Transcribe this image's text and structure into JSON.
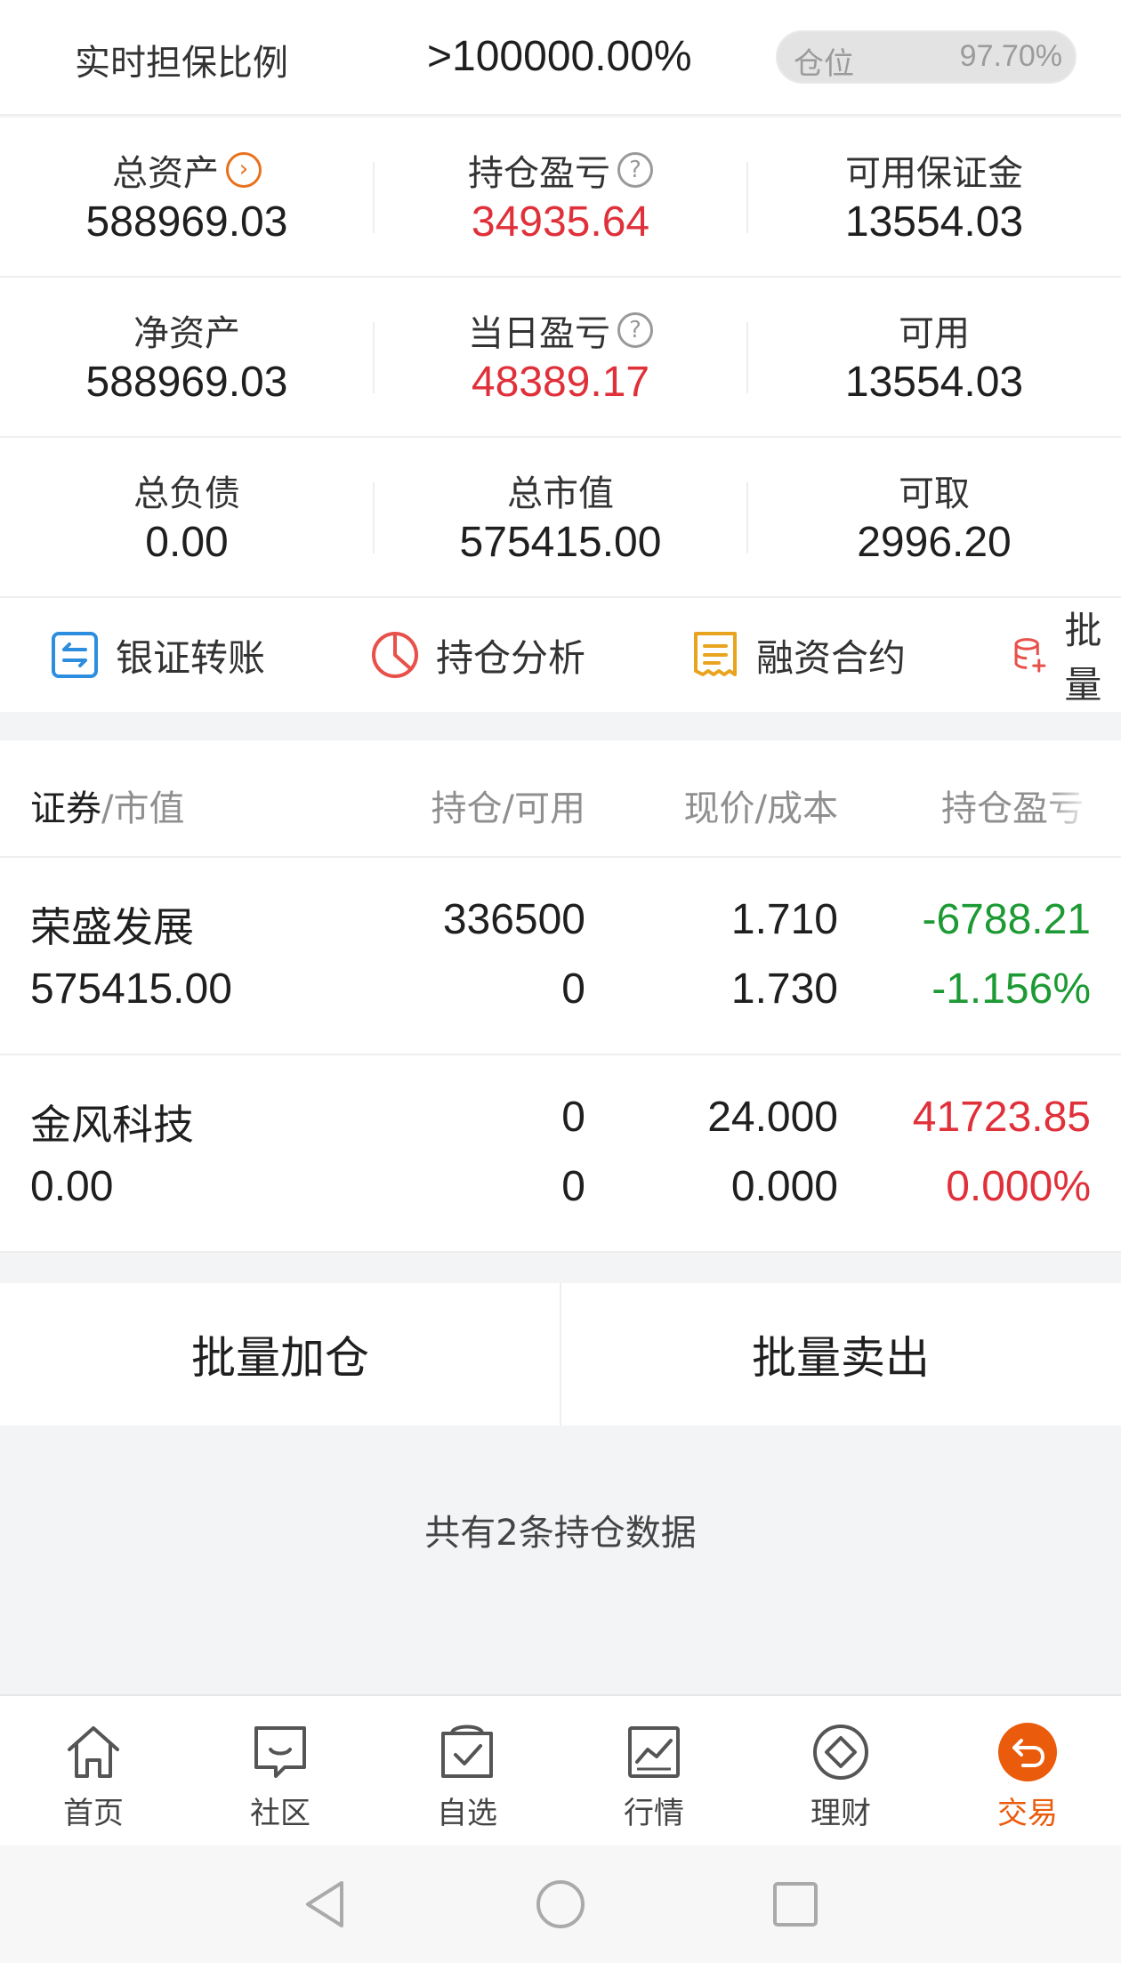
{
  "header": {
    "label": "实时担保比例",
    "ratio": ">100000.00%",
    "position_label": "仓位",
    "position_value": "97.70%"
  },
  "assets": {
    "row1": [
      {
        "label": "总资产",
        "value": "588969.03",
        "icon": "chevron-right-circle-icon",
        "color": "#1f1f1f"
      },
      {
        "label": "持仓盈亏",
        "value": "34935.64",
        "icon": "question-circle-icon",
        "color": "#e0303a"
      },
      {
        "label": "可用保证金",
        "value": "13554.03",
        "color": "#1f1f1f"
      }
    ],
    "row2": [
      {
        "label": "净资产",
        "value": "588969.03",
        "color": "#1f1f1f"
      },
      {
        "label": "当日盈亏",
        "value": "48389.17",
        "icon": "question-circle-icon",
        "color": "#e0303a"
      },
      {
        "label": "可用",
        "value": "13554.03",
        "color": "#1f1f1f"
      }
    ],
    "row3": [
      {
        "label": "总负债",
        "value": "0.00",
        "color": "#1f1f1f"
      },
      {
        "label": "总市值",
        "value": "575415.00",
        "color": "#1f1f1f"
      },
      {
        "label": "可取",
        "value": "2996.20",
        "color": "#1f1f1f"
      }
    ]
  },
  "actions": [
    {
      "label": "银证转账",
      "icon": "transfer-icon"
    },
    {
      "label": "持仓分析",
      "icon": "pie-chart-icon"
    },
    {
      "label": "融资合约",
      "icon": "contract-icon"
    },
    {
      "label": "批量",
      "icon": "database-add-icon"
    }
  ],
  "table": {
    "headers": {
      "security": "证券",
      "market_value": "/市值",
      "holding": "持仓/可用",
      "price": "现价/成本",
      "pnl": "持仓盈亏"
    },
    "rows": [
      {
        "name": "荣盛发展",
        "market_value": "575415.00",
        "holding": "336500",
        "available": "0",
        "price": "1.710",
        "cost": "1.730",
        "pnl": "-6788.21",
        "pnl_pct": "-1.156%",
        "trend": "down"
      },
      {
        "name": "金风科技",
        "market_value": "0.00",
        "holding": "0",
        "available": "0",
        "price": "24.000",
        "cost": "0.000",
        "pnl": "41723.85",
        "pnl_pct": "0.000%",
        "trend": "up"
      }
    ]
  },
  "batch": {
    "add": "批量加仓",
    "sell": "批量卖出"
  },
  "footer_text": "共有2条持仓数据",
  "nav": [
    {
      "label": "首页",
      "icon": "home-icon",
      "active": false
    },
    {
      "label": "社区",
      "icon": "chat-icon",
      "active": false
    },
    {
      "label": "自选",
      "icon": "watchlist-icon",
      "active": false
    },
    {
      "label": "行情",
      "icon": "market-chart-icon",
      "active": false
    },
    {
      "label": "理财",
      "icon": "diamond-icon",
      "active": false
    },
    {
      "label": "交易",
      "icon": "trade-icon",
      "active": true
    }
  ],
  "colors": {
    "up": "#e0303a",
    "down": "#1d9a34",
    "accent": "#ea5b0c"
  }
}
